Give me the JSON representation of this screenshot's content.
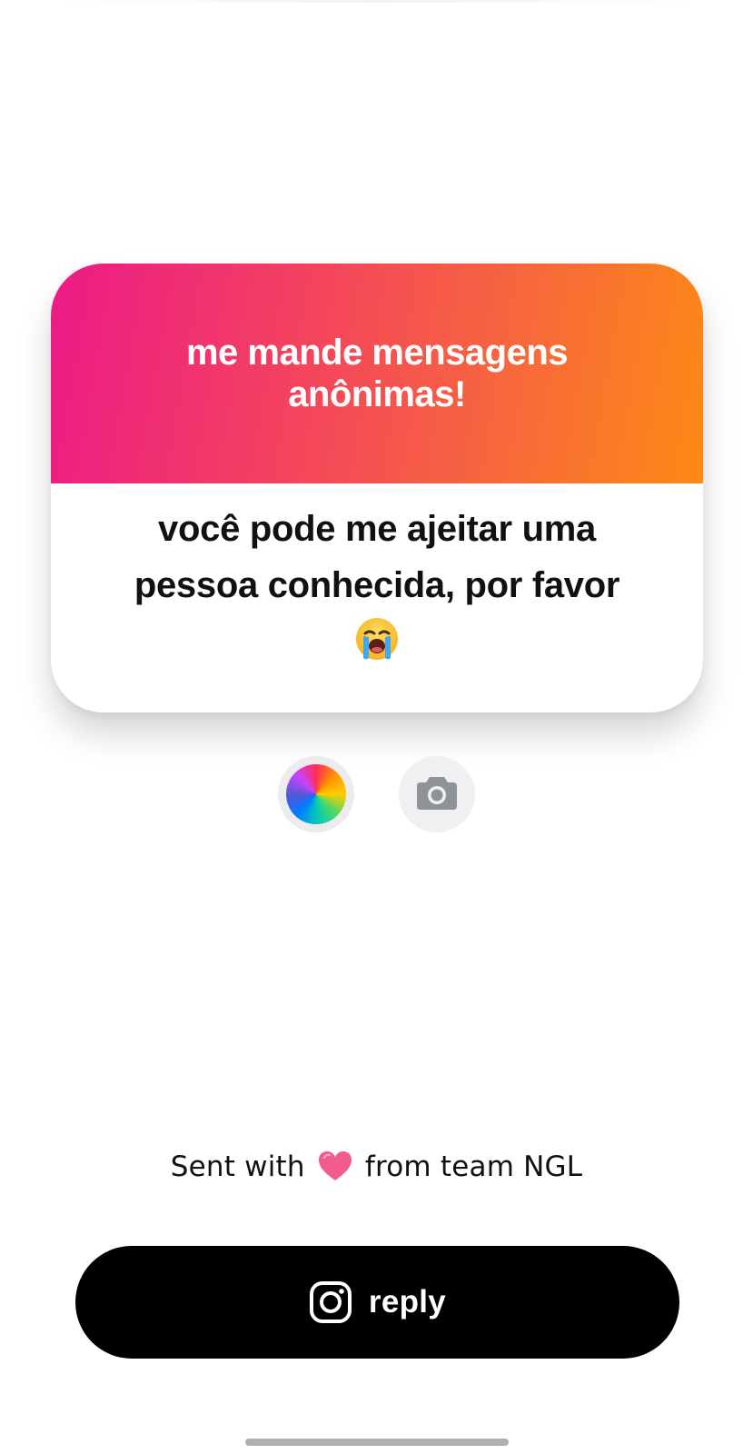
{
  "card": {
    "title": "me mande mensagens anônimas!",
    "message": "você pode me ajeitar uma pessoa conhecida, por favor",
    "message_emoji": "😭",
    "header_gradient": [
      "#ec1a87",
      "#fd8a15"
    ]
  },
  "tools": {
    "color_icon": "color-wheel-icon",
    "camera_icon": "camera-icon"
  },
  "footer": {
    "prefix": "Sent with",
    "heart_icon": "heart-icon",
    "suffix": "from team NGL"
  },
  "reply_button": {
    "label": "reply",
    "icon": "instagram-icon",
    "background": "#000000"
  }
}
